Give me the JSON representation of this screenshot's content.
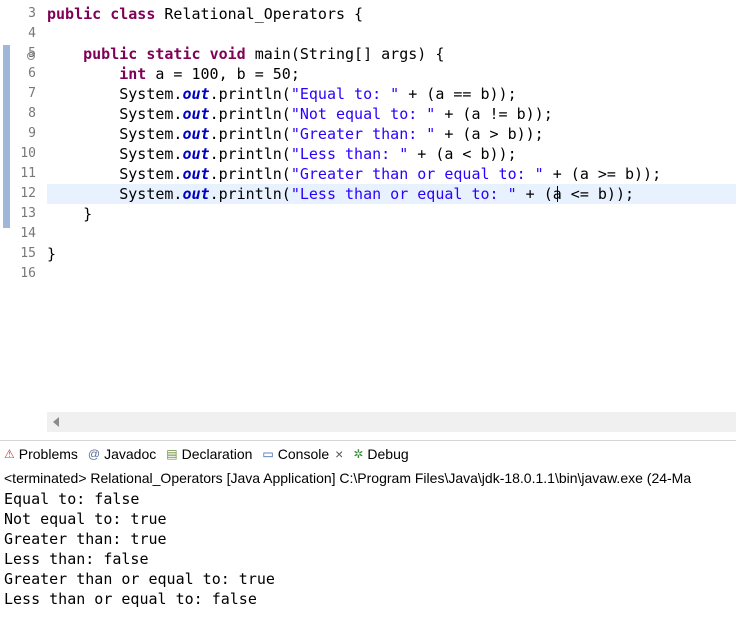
{
  "editor": {
    "line_numbers": [
      "3",
      "4",
      "5",
      "6",
      "7",
      "8",
      "9",
      "10",
      "11",
      "12",
      "13",
      "14",
      "15",
      "16"
    ],
    "fold_marker": "⊖",
    "lines": [
      [
        {
          "t": "kw",
          "v": "public"
        },
        {
          "t": "plain",
          "v": " "
        },
        {
          "t": "kw",
          "v": "class"
        },
        {
          "t": "plain",
          "v": " Relational_Operators {"
        }
      ],
      [],
      [
        {
          "t": "plain",
          "v": "    "
        },
        {
          "t": "kw",
          "v": "public"
        },
        {
          "t": "plain",
          "v": " "
        },
        {
          "t": "kw",
          "v": "static"
        },
        {
          "t": "plain",
          "v": " "
        },
        {
          "t": "kw",
          "v": "void"
        },
        {
          "t": "plain",
          "v": " main(String[] args) {"
        }
      ],
      [
        {
          "t": "plain",
          "v": "        "
        },
        {
          "t": "kw",
          "v": "int"
        },
        {
          "t": "plain",
          "v": " a = 100, b = 50;"
        }
      ],
      [
        {
          "t": "plain",
          "v": "        System."
        },
        {
          "t": "fld",
          "v": "out"
        },
        {
          "t": "plain",
          "v": ".println("
        },
        {
          "t": "str",
          "v": "\"Equal to: \""
        },
        {
          "t": "plain",
          "v": " + (a == b));"
        }
      ],
      [
        {
          "t": "plain",
          "v": "        System."
        },
        {
          "t": "fld",
          "v": "out"
        },
        {
          "t": "plain",
          "v": ".println("
        },
        {
          "t": "str",
          "v": "\"Not equal to: \""
        },
        {
          "t": "plain",
          "v": " + (a != b));"
        }
      ],
      [
        {
          "t": "plain",
          "v": "        System."
        },
        {
          "t": "fld",
          "v": "out"
        },
        {
          "t": "plain",
          "v": ".println("
        },
        {
          "t": "str",
          "v": "\"Greater than: \""
        },
        {
          "t": "plain",
          "v": " + (a > b));"
        }
      ],
      [
        {
          "t": "plain",
          "v": "        System."
        },
        {
          "t": "fld",
          "v": "out"
        },
        {
          "t": "plain",
          "v": ".println("
        },
        {
          "t": "str",
          "v": "\"Less than: \""
        },
        {
          "t": "plain",
          "v": " + (a < b));"
        }
      ],
      [
        {
          "t": "plain",
          "v": "        System."
        },
        {
          "t": "fld",
          "v": "out"
        },
        {
          "t": "plain",
          "v": ".println("
        },
        {
          "t": "str",
          "v": "\"Greater than or equal to: \""
        },
        {
          "t": "plain",
          "v": " + (a >= b));"
        }
      ],
      [
        {
          "t": "plain",
          "v": "        System."
        },
        {
          "t": "fld",
          "v": "out"
        },
        {
          "t": "plain",
          "v": ".println("
        },
        {
          "t": "str",
          "v": "\"Less than or equal to: \""
        },
        {
          "t": "plain",
          "v": " + (a <= b));"
        }
      ],
      [
        {
          "t": "plain",
          "v": "    }"
        }
      ],
      [],
      [
        {
          "t": "plain",
          "v": "}"
        }
      ],
      []
    ]
  },
  "panel": {
    "tabs": [
      {
        "label": "Problems",
        "icon": "problems-icon",
        "glyph": "⚠",
        "color": "#c04040"
      },
      {
        "label": "Javadoc",
        "icon": "javadoc-icon",
        "glyph": "@",
        "color": "#5a6f9a"
      },
      {
        "label": "Declaration",
        "icon": "declaration-icon",
        "glyph": "▤",
        "color": "#6a8a3a"
      },
      {
        "label": "Console",
        "icon": "console-icon",
        "glyph": "▭",
        "color": "#2f5fa8",
        "active": true,
        "close": "×"
      },
      {
        "label": "Debug",
        "icon": "debug-icon",
        "glyph": "✲",
        "color": "#3a8a3a"
      }
    ],
    "console_header": "<terminated> Relational_Operators [Java Application] C:\\Program Files\\Java\\jdk-18.0.1.1\\bin\\javaw.exe  (24-Ma",
    "output": [
      "Equal to: false",
      "Not equal to: true",
      "Greater than: true",
      "Less than: false",
      "Greater than or equal to: true",
      "Less than or equal to: false"
    ]
  }
}
